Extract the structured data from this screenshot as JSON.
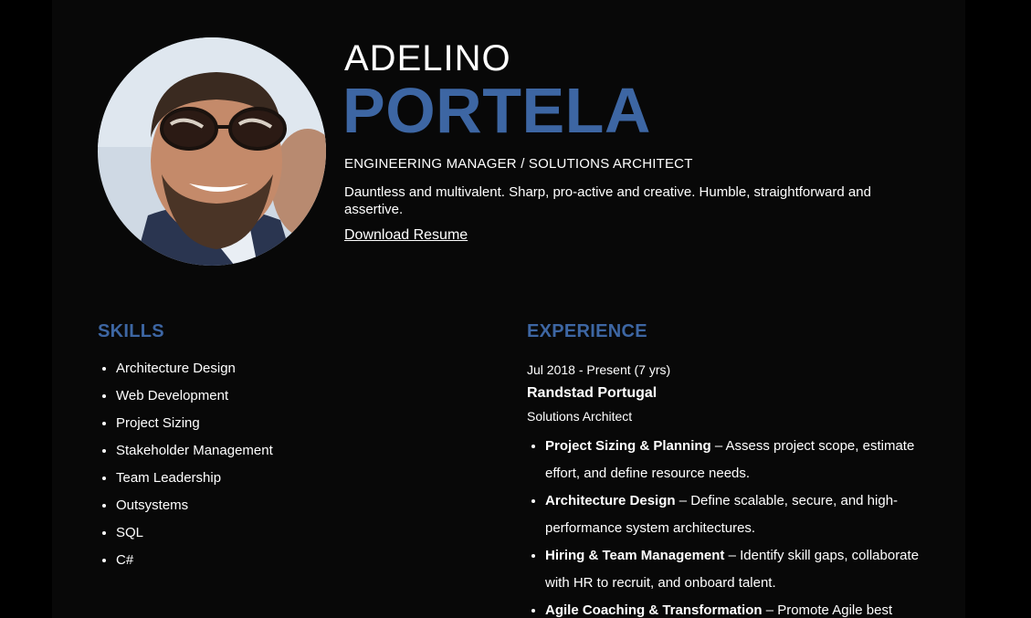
{
  "profile": {
    "first_name": "ADELINO",
    "last_name": "PORTELA",
    "role": "ENGINEERING MANAGER / SOLUTIONS ARCHITECT",
    "tagline": "Dauntless and multivalent. Sharp, pro-active and creative. Humble, straightforward and assertive.",
    "download_label": "Download Resume",
    "avatar_icon": "profile-photo"
  },
  "skills": {
    "title": "SKILLS",
    "items": [
      "Architecture Design",
      "Web Development",
      "Project Sizing",
      "Stakeholder Management",
      "Team Leadership",
      "Outsystems",
      "SQL",
      "C#"
    ]
  },
  "experience": {
    "title": "EXPERIENCE",
    "entries": [
      {
        "dates": "Jul 2018 - Present (7 yrs)",
        "company": "Randstad Portugal",
        "position": "Solutions Architect",
        "highlights": [
          {
            "title": "Project Sizing & Planning",
            "text": " – Assess project scope, estimate effort, and define resource needs."
          },
          {
            "title": "Architecture Design",
            "text": " – Define scalable, secure, and high-performance system architectures."
          },
          {
            "title": "Hiring & Team Management",
            "text": " – Identify skill gaps, collaborate with HR to recruit, and onboard talent."
          },
          {
            "title": "Agile Coaching & Transformation",
            "text": " – Promote Agile best"
          }
        ]
      }
    ]
  },
  "colors": {
    "accent": "#3d66a3",
    "background": "#000000",
    "panel": "#080808",
    "text": "#ffffff"
  }
}
